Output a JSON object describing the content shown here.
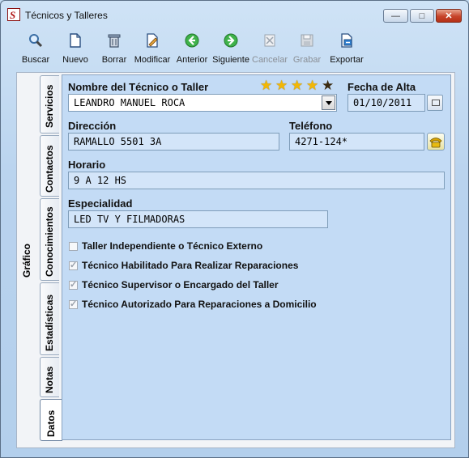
{
  "window": {
    "title": "Técnicos y Talleres"
  },
  "toolbar": {
    "buttons": [
      {
        "label": "Buscar",
        "icon": "search-icon",
        "enabled": true
      },
      {
        "label": "Nuevo",
        "icon": "new-document-icon",
        "enabled": true
      },
      {
        "label": "Borrar",
        "icon": "trash-icon",
        "enabled": true
      },
      {
        "label": "Modificar",
        "icon": "edit-icon",
        "enabled": true
      },
      {
        "label": "Anterior",
        "icon": "arrow-left-icon",
        "enabled": true
      },
      {
        "label": "Siguiente",
        "icon": "arrow-right-icon",
        "enabled": true
      },
      {
        "label": "Cancelar",
        "icon": "cancel-icon",
        "enabled": false
      },
      {
        "label": "Grabar",
        "icon": "save-icon",
        "enabled": false
      },
      {
        "label": "Exportar",
        "icon": "export-icon",
        "enabled": true
      }
    ]
  },
  "side_tab": {
    "label": "Gráfico"
  },
  "tabs": [
    "Servicios",
    "Contactos",
    "Conocimientos",
    "Estadísticas",
    "Notas",
    "Datos"
  ],
  "active_tab": "Datos",
  "form": {
    "nombre_label": "Nombre del Técnico o Taller",
    "nombre_value": "LEANDRO MANUEL ROCA",
    "rating": 4,
    "rating_max": 5,
    "fecha_label": "Fecha de Alta",
    "fecha_value": "01/10/2011",
    "direccion_label": "Dirección",
    "direccion_value": "RAMALLO 5501 3A",
    "telefono_label": "Teléfono",
    "telefono_value": "4271-124*",
    "horario_label": "Horario",
    "horario_value": "9 A 12 HS",
    "especialidad_label": "Especialidad",
    "especialidad_value": "LED TV Y FILMADORAS"
  },
  "checkboxes": [
    {
      "label": "Taller Independiente o Técnico Externo",
      "checked": false
    },
    {
      "label": "Técnico Habilitado Para Realizar Reparaciones",
      "checked": true
    },
    {
      "label": "Técnico Supervisor o Encargado del Taller",
      "checked": true
    },
    {
      "label": "Técnico Autorizado Para Reparaciones a Domicilio",
      "checked": true
    }
  ],
  "colors": {
    "star_on": "#f2b705",
    "star_off": "#3a2a10",
    "accent": "#b01515"
  }
}
